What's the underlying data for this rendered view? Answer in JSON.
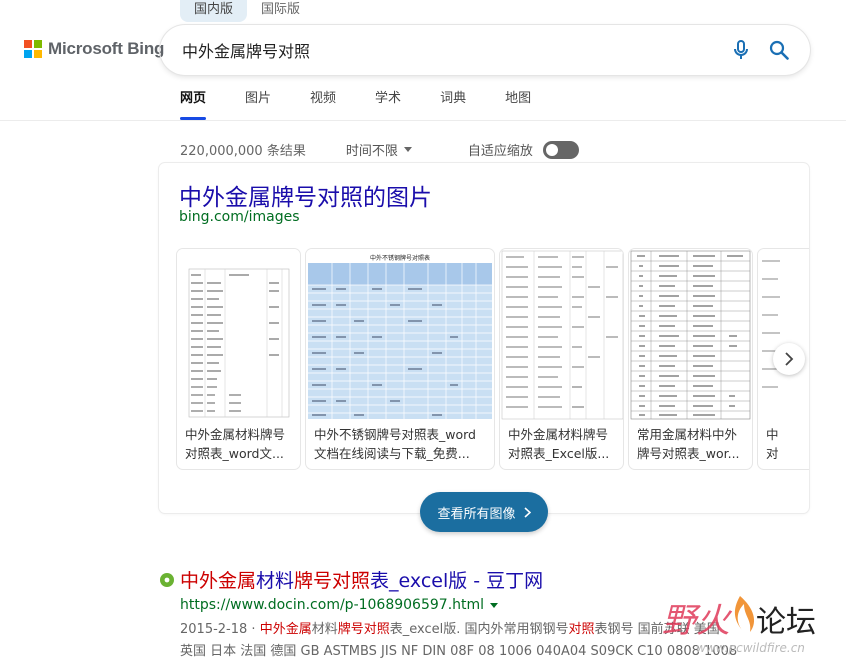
{
  "colors": {
    "accent": "#174ae4",
    "link": "#1a0dab",
    "url": "#006d21",
    "button": "#1b6ea0",
    "highlight": "#c00000"
  },
  "market_tabs": [
    "国内版",
    "国际版"
  ],
  "logo": {
    "text": "Microsoft Bing"
  },
  "search": {
    "value": "中外金属牌号对照"
  },
  "scopes": [
    "网页",
    "图片",
    "视频",
    "学术",
    "词典",
    "地图"
  ],
  "tools": {
    "result_count": "220,000,000 条结果",
    "time_filter": "时间不限",
    "autoscale_label": "自适应缩放",
    "autoscale_on": false
  },
  "image_answer": {
    "title": "中外金属牌号对照的图片",
    "url": "bing.com/images",
    "thumbs": [
      {
        "caption1": "中外金属材料牌号",
        "caption2": "对照表_word文..."
      },
      {
        "caption1": "中外不锈钢牌号对照表_word",
        "caption2": "文档在线阅读与下载_免费..."
      },
      {
        "caption1": "中外金属材料牌号",
        "caption2": "对照表_Excel版..."
      },
      {
        "caption1": "常用金属材料中外",
        "caption2": "牌号对照表_wor..."
      },
      {
        "caption1": "中",
        "caption2": "对"
      }
    ],
    "thumb_table_title": "中外不锈钢牌号对照表",
    "see_all": "查看所有图像"
  },
  "result": {
    "title_a": "中外金属",
    "title_b": "材料",
    "title_c": "牌号对照",
    "title_d": "表_excel版 - 豆丁网",
    "url": "https://www.docin.com/p-1068906597.html",
    "date": "2015-2-18",
    "snip_sep": " · ",
    "snip_a": "中外金属",
    "snip_b": "材料",
    "snip_c": "牌号对照",
    "snip_d": "表_excel版. 国内外常用钢钢号",
    "snip_e": "对照",
    "snip_f": "表钢号 国前苏联 美国",
    "snip_line2": "英国 日本 法国 德国 GB ASTMBS JIS NF DIN 08F 08 1006 040A04 S09CK C10 0808 1008"
  },
  "watermark": {
    "text_a": "野火",
    "text_b": "论坛",
    "url": "www.pcwildfire.cn"
  }
}
